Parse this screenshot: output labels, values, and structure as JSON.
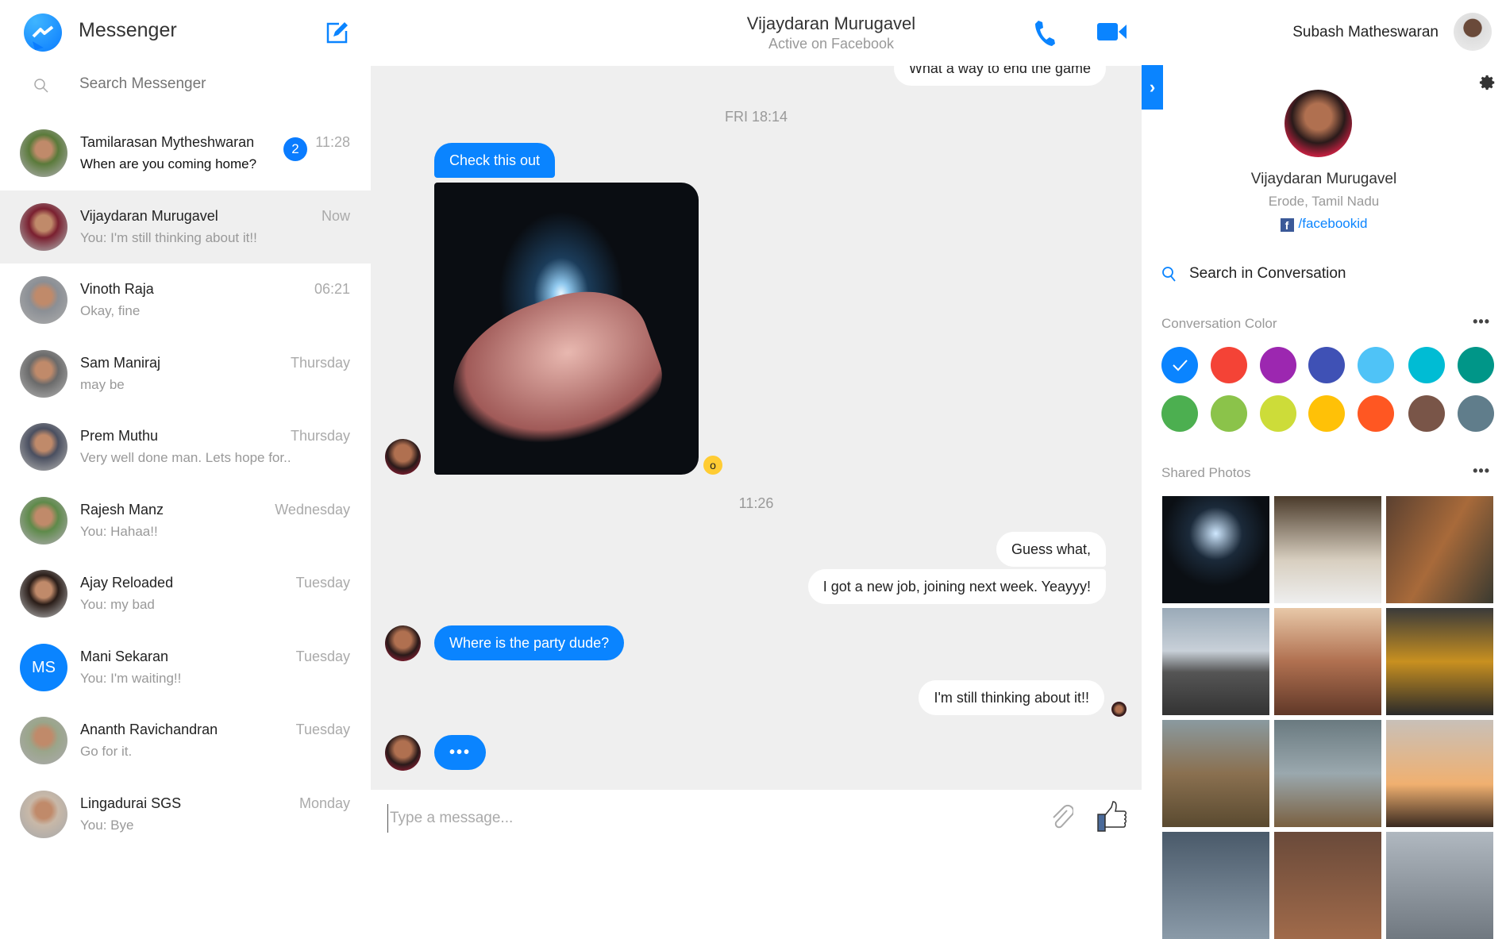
{
  "app": {
    "title": "Messenger",
    "search_placeholder": "Search Messenger"
  },
  "conversations": [
    {
      "name": "Tamilarasan Mytheshwaran",
      "preview": "When are you coming home?",
      "time": "11:28",
      "unread": "2",
      "avatar": "#5a7a3a"
    },
    {
      "name": "Vijaydaran Murugavel",
      "preview": "You: I'm still thinking about it!!",
      "time": "Now",
      "selected": true,
      "avatar": "#7a2030"
    },
    {
      "name": "Vinoth Raja",
      "preview": "Okay, fine",
      "time": "06:21",
      "avatar": "#8b8f95"
    },
    {
      "name": "Sam Maniraj",
      "preview": "may be",
      "time": "Thursday",
      "avatar": "#6a6a6a"
    },
    {
      "name": "Prem Muthu",
      "preview": "Very well done man. Lets hope for..",
      "time": "Thursday",
      "avatar": "#4a4f60"
    },
    {
      "name": "Rajesh Manz",
      "preview": "You: Hahaa!!",
      "time": "Wednesday",
      "avatar": "#5e8a4a"
    },
    {
      "name": "Ajay Reloaded",
      "preview": "You: my bad",
      "time": "Tuesday",
      "avatar": "#2a1d18"
    },
    {
      "name": "Mani Sekaran",
      "preview": "You: I'm waiting!!",
      "time": "Tuesday",
      "initials": "MS"
    },
    {
      "name": "Ananth Ravichandran",
      "preview": "Go for it.",
      "time": "Tuesday",
      "avatar": "#9aa58a"
    },
    {
      "name": "Lingadurai SGS",
      "preview": "You: Bye",
      "time": "Monday",
      "avatar": "#c8b8a8"
    }
  ],
  "header": {
    "contact": "Vijaydaran Murugavel",
    "status": "Active on Facebook",
    "user": "Subash Matheswaran"
  },
  "messages": {
    "m0": "What a way to end the game",
    "ts1": "FRI 18:14",
    "m1": "Check this out",
    "ts2": "11:26",
    "m2": "Guess what,",
    "m3": "I got a new job, joining next week. Yeayyy!",
    "m4": "Where is the party dude?",
    "m5": "I'm still thinking about it!!",
    "typing": "•••"
  },
  "composer": {
    "placeholder": "Type a message..."
  },
  "profile": {
    "name": "Vijaydaran Murugavel",
    "location": "Erode, Tamil Nadu",
    "facebook": "/facebookid",
    "search": "Search in Conversation"
  },
  "colors": {
    "label": "Conversation Color",
    "selected": "#0a84ff",
    "swatches": [
      "#0a84ff",
      "#f44336",
      "#9c27b0",
      "#3f51b5",
      "#4fc3f7",
      "#00bcd4",
      "#009688",
      "#4caf50",
      "#8bc34a",
      "#cddc39",
      "#ffc107",
      "#ff5722",
      "#795548",
      "#607d8b"
    ]
  },
  "photos": {
    "label": "Shared Photos",
    "items": [
      "radial-gradient(circle at 50% 35%,#cfe8ff,#1b2a3a 30%,#0b0f14 60%),#111",
      "linear-gradient(#4a3a2a,#d8cfc0 60%,#eee)",
      "linear-gradient(120deg,#5a4030,#a86a3a 50%,#3a3a30)",
      "linear-gradient(#9aaab8,#c8d0d8 40%,#555 60%,#333)",
      "linear-gradient(#e8c8a8,#b07050 50%,#603828)",
      "linear-gradient(#3a3a3a,#c89020 50%,#2a2a2a)",
      "linear-gradient(#8a9aa0,#8a7050 50%,#5a4a30)",
      "linear-gradient(#6a7a80,#9aa8ae 50%,#7a6040)",
      "linear-gradient(#c8c0b8,#f0b070 60%,#3a2a20)",
      "linear-gradient(#4a5a6a,#8a9aa8)",
      "linear-gradient(#6a4a3a,#a06a4a)",
      "linear-gradient(#b0b8c0,#707880)"
    ]
  }
}
